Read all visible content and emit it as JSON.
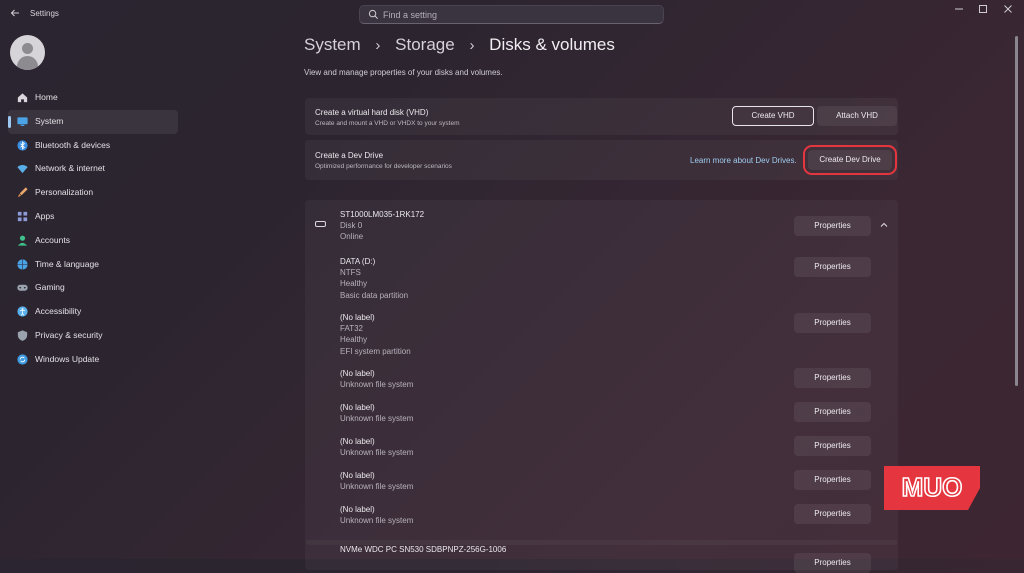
{
  "app": {
    "title": "Settings"
  },
  "search": {
    "placeholder": "Find a setting"
  },
  "nav": {
    "items": [
      {
        "label": "Home",
        "icon": "home-icon",
        "color": "#d9d5dc"
      },
      {
        "label": "System",
        "icon": "system-icon",
        "color": "#4ba3e8",
        "active": true
      },
      {
        "label": "Bluetooth & devices",
        "icon": "bluetooth-icon",
        "color": "#3c8fe0"
      },
      {
        "label": "Network & internet",
        "icon": "wifi-icon",
        "color": "#5aaee8"
      },
      {
        "label": "Personalization",
        "icon": "brush-icon",
        "color": "#e8a76b"
      },
      {
        "label": "Apps",
        "icon": "apps-icon",
        "color": "#8d9bd8"
      },
      {
        "label": "Accounts",
        "icon": "account-icon",
        "color": "#3fbf8a"
      },
      {
        "label": "Time & language",
        "icon": "globe-icon",
        "color": "#4aa4e6"
      },
      {
        "label": "Gaming",
        "icon": "gaming-icon",
        "color": "#9aa3ad"
      },
      {
        "label": "Accessibility",
        "icon": "accessibility-icon",
        "color": "#5ab0ec"
      },
      {
        "label": "Privacy & security",
        "icon": "shield-icon",
        "color": "#9aa3ad"
      },
      {
        "label": "Windows Update",
        "icon": "update-icon",
        "color": "#3f9ae0"
      }
    ]
  },
  "breadcrumb": {
    "part1": "System",
    "part2": "Storage",
    "part3": "Disks & volumes"
  },
  "subtitle": "View and manage properties of your disks and volumes.",
  "vhd": {
    "title": "Create a virtual hard disk (VHD)",
    "desc": "Create and mount a VHD or VHDX to your system",
    "create_label": "Create VHD",
    "attach_label": "Attach VHD"
  },
  "devdrive": {
    "title": "Create a Dev Drive",
    "desc": "Optimized performance for developer scenarios",
    "link": "Learn more about Dev Drives.",
    "button_label": "Create Dev Drive"
  },
  "disk": {
    "name": "ST1000LM035-1RK172",
    "number": "Disk 0",
    "status": "Online",
    "properties_label": "Properties",
    "volumes": [
      {
        "label": "DATA (D:)",
        "lines": [
          "NTFS",
          "Healthy",
          "Basic data partition"
        ],
        "properties_label": "Properties"
      },
      {
        "label": "(No label)",
        "lines": [
          "FAT32",
          "Healthy",
          "EFI system partition"
        ],
        "properties_label": "Properties"
      },
      {
        "label": "(No label)",
        "lines": [
          "Unknown file system"
        ],
        "properties_label": "Properties"
      },
      {
        "label": "(No label)",
        "lines": [
          "Unknown file system"
        ],
        "properties_label": "Properties"
      },
      {
        "label": "(No label)",
        "lines": [
          "Unknown file system"
        ],
        "properties_label": "Properties"
      },
      {
        "label": "(No label)",
        "lines": [
          "Unknown file system"
        ],
        "properties_label": "Properties"
      },
      {
        "label": "(No label)",
        "lines": [
          "Unknown file system"
        ],
        "properties_label": "Properties"
      }
    ]
  },
  "disk2": {
    "name": "NVMe WDC PC SN530 SDBPNPZ-256G-1006",
    "properties_label": "Properties"
  },
  "watermark": {
    "text": "MUO",
    "color": "#e5363f"
  },
  "colors": {
    "highlight": "#e5363f",
    "link": "#9fcdf0",
    "accent": "#9fc8f0"
  }
}
